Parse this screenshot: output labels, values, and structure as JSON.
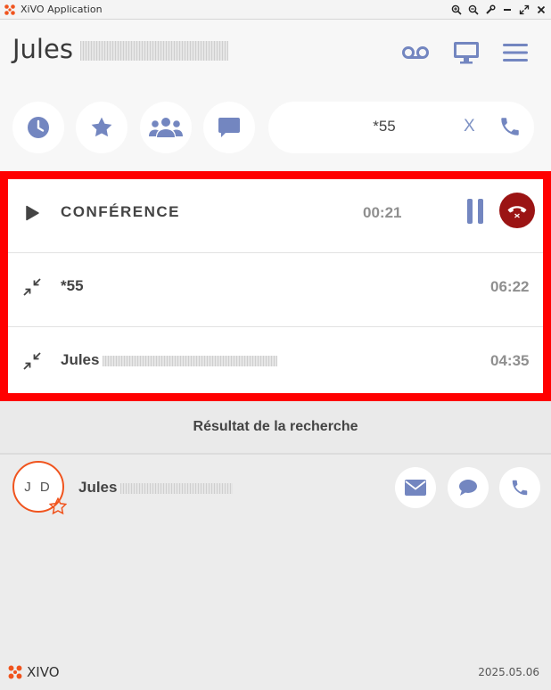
{
  "window": {
    "title": "XiVO Application"
  },
  "header": {
    "user_first_name": "Jules"
  },
  "search": {
    "value": "*55",
    "placeholder": "",
    "clear_label": "X"
  },
  "calls": [
    {
      "name": "CONFÉRENCE",
      "timer": "00:21"
    },
    {
      "name": "*55",
      "timer": "06:22"
    },
    {
      "name": "Jules",
      "timer": "04:35"
    }
  ],
  "results": {
    "title": "Résultat de la recherche",
    "contact": {
      "initials": "J D",
      "first_name": "Jules"
    }
  },
  "footer": {
    "brand": "XIVO",
    "version": "2025.05.06"
  },
  "colors": {
    "accent": "#7386c0",
    "hangup": "#9b1414",
    "highlight_border": "#ff0000",
    "avatar_ring": "#f0541e"
  }
}
